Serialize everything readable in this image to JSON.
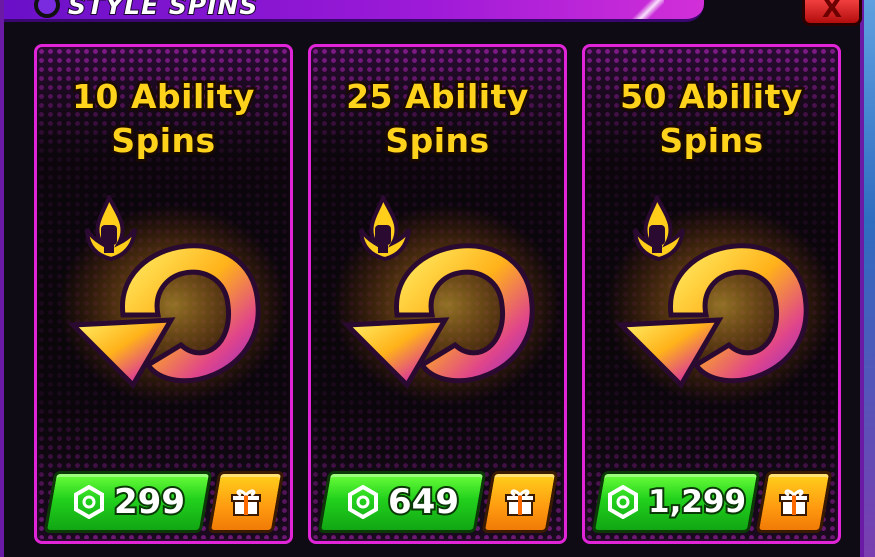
{
  "window": {
    "title": "STYLE SPINS",
    "close_label": "X"
  },
  "colors": {
    "accent": "#e025d8",
    "title_text": "#ffd21c",
    "price_green": "#22d11c",
    "gift_orange": "#ff9a10",
    "close_red": "#d21a1a"
  },
  "cards": [
    {
      "title_line1": "10 Ability",
      "title_line2": "Spins",
      "price": "299",
      "currency_icon": "robux-icon",
      "gift_icon": "gift-icon",
      "art_icon": "ability-spin-arrow-icon"
    },
    {
      "title_line1": "25 Ability",
      "title_line2": "Spins",
      "price": "649",
      "currency_icon": "robux-icon",
      "gift_icon": "gift-icon",
      "art_icon": "ability-spin-arrow-icon"
    },
    {
      "title_line1": "50 Ability",
      "title_line2": "Spins",
      "price": "1,299",
      "currency_icon": "robux-icon",
      "gift_icon": "gift-icon",
      "art_icon": "ability-spin-arrow-icon"
    }
  ]
}
